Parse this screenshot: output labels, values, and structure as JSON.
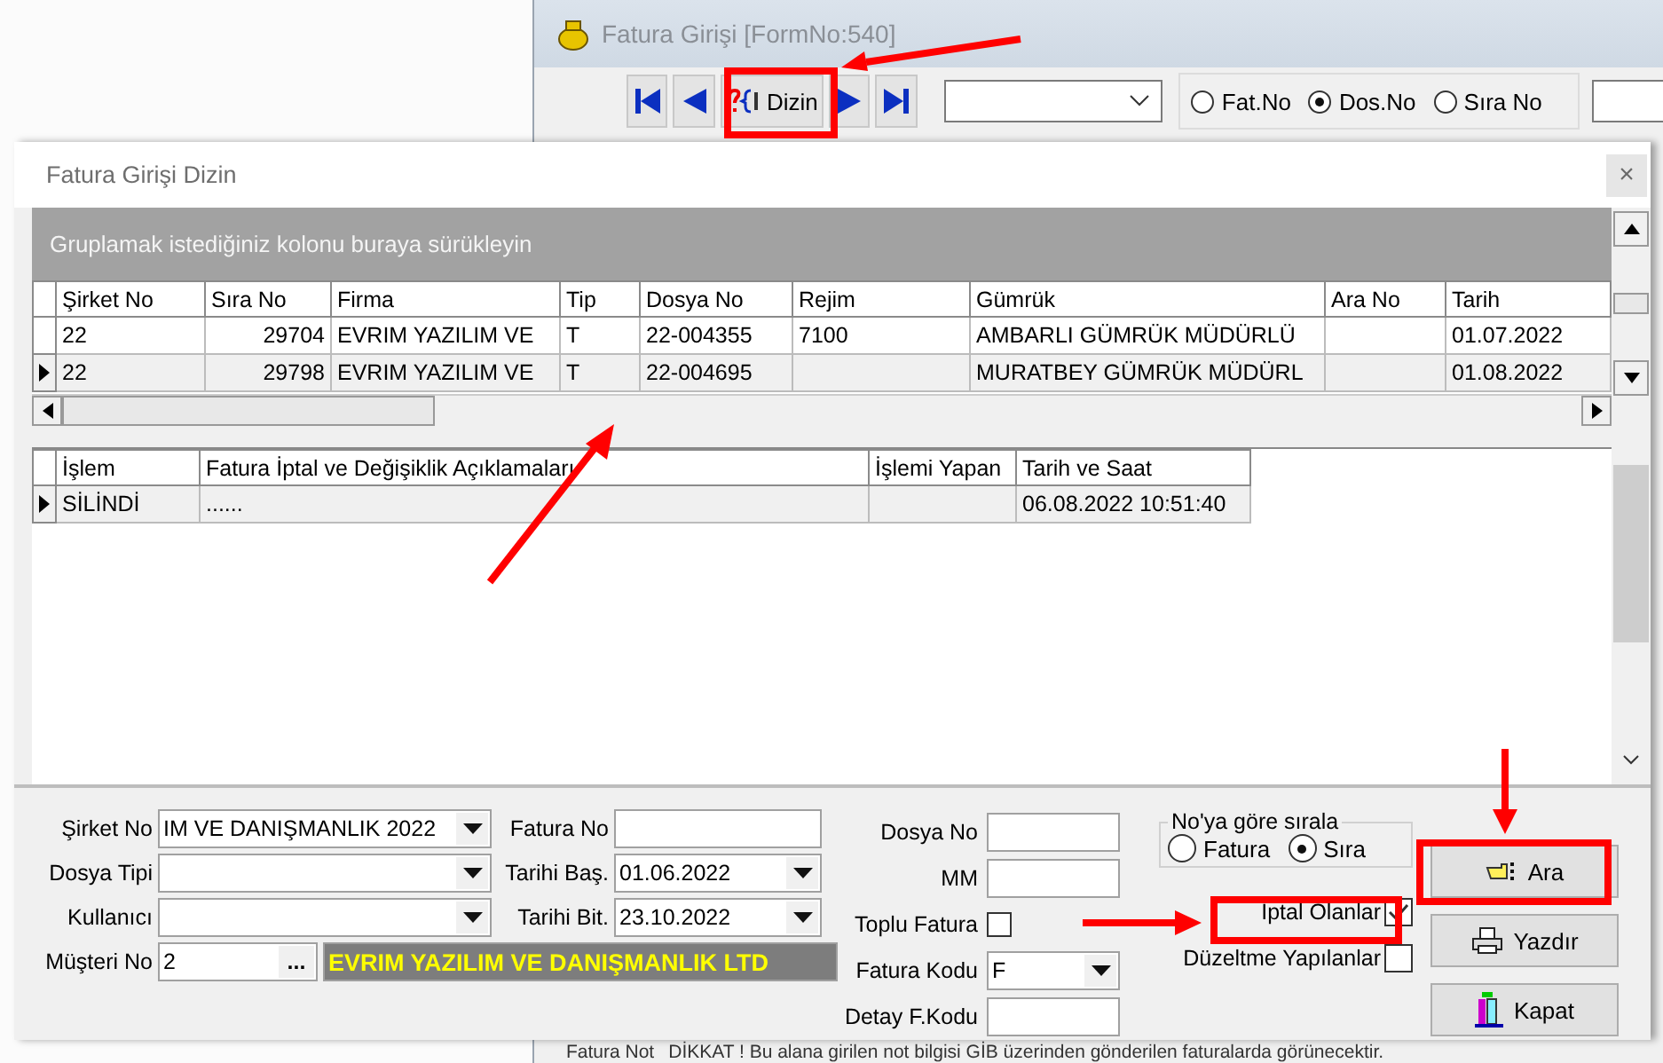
{
  "main_window": {
    "title": "Fatura Girişi [FormNo:540]",
    "nav_buttons": [
      {
        "kind": "first"
      },
      {
        "kind": "prev"
      },
      {
        "kind": "index",
        "label": "Dizin"
      },
      {
        "kind": "next"
      },
      {
        "kind": "last"
      }
    ],
    "search_by": [
      {
        "label": "Fat.No",
        "selected": false
      },
      {
        "label": "Dos.No",
        "selected": true
      },
      {
        "label": "Sıra No",
        "selected": false
      }
    ],
    "note": {
      "label": "Fatura Not",
      "text": "DİKKAT ! Bu alana girilen not bilgisi GİB üzerinden gönderilen faturalarda görünecektir."
    }
  },
  "dialog": {
    "title": "Fatura Girişi Dizin",
    "close": "×",
    "group_hint": "Gruplamak istediğiniz kolonu buraya sürükleyin",
    "invoice_grid": {
      "columns": [
        "Şirket No",
        "Sıra No",
        "Firma",
        "Tip",
        "Dosya No",
        "Rejim",
        "Gümrük",
        "Ara No",
        "Tarih"
      ],
      "rows": [
        {
          "current": false,
          "cells": [
            "22",
            "29704",
            "EVRIM YAZILIM VE",
            "T",
            "22-004355",
            "7100",
            "AMBARLI  GÜMRÜK MÜDÜRLÜ",
            null,
            "01.07.2022"
          ]
        },
        {
          "current": true,
          "cells": [
            "22",
            "29798",
            "EVRIM YAZILIM VE",
            "T",
            "22-004695",
            null,
            "MURATBEY GÜMRÜK MÜDÜRL",
            null,
            "01.08.2022"
          ]
        }
      ]
    },
    "log_grid": {
      "columns": [
        "İşlem",
        "Fatura İptal ve Değişiklik Açıklamaları",
        "İşlemi Yapan",
        "Tarih ve Saat"
      ],
      "rows": [
        {
          "current": true,
          "cells": [
            "SİLİNDİ",
            "......",
            null,
            "06.08.2022 10:51:40"
          ]
        }
      ]
    },
    "filters": {
      "company": {
        "label": "Şirket No",
        "value": "IM  VE DANIŞMANLIK 2022"
      },
      "invoice_no": {
        "label": "Fatura No"
      },
      "file_type": {
        "label": "Dosya Tipi"
      },
      "date_from": {
        "label": "Tarihi Baş.",
        "value": "01.06.2022"
      },
      "user": {
        "label": "Kullanıcı"
      },
      "date_to": {
        "label": "Tarihi Bit.",
        "value": "23.10.2022"
      },
      "customer": {
        "label": "Müşteri No",
        "value": "2",
        "button": "...",
        "name": "EVRIM YAZILIM VE DANIŞMANLIK LTD"
      }
    },
    "middle_fields": [
      {
        "kind": "text",
        "label": "Dosya No"
      },
      {
        "kind": "text",
        "label": "MM"
      },
      {
        "kind": "checkbox",
        "label": "Toplu Fatura",
        "checked": false
      },
      {
        "kind": "combo",
        "label": "Fatura Kodu",
        "value": "F"
      },
      {
        "kind": "text",
        "label": "Detay F.Kodu"
      }
    ],
    "sort": {
      "title": "No'ya göre sırala",
      "options": [
        {
          "label": "Fatura",
          "selected": false
        },
        {
          "label": "Sıra",
          "selected": true
        }
      ]
    },
    "checkboxes": [
      {
        "label": "İptal Olanlar",
        "checked": true
      },
      {
        "label": "Düzeltme Yapılanlar",
        "checked": false
      }
    ],
    "buttons": [
      {
        "kind": "search",
        "label": "Ara"
      },
      {
        "kind": "print",
        "label": "Yazdır"
      },
      {
        "kind": "close",
        "label": "Kapat"
      }
    ]
  }
}
